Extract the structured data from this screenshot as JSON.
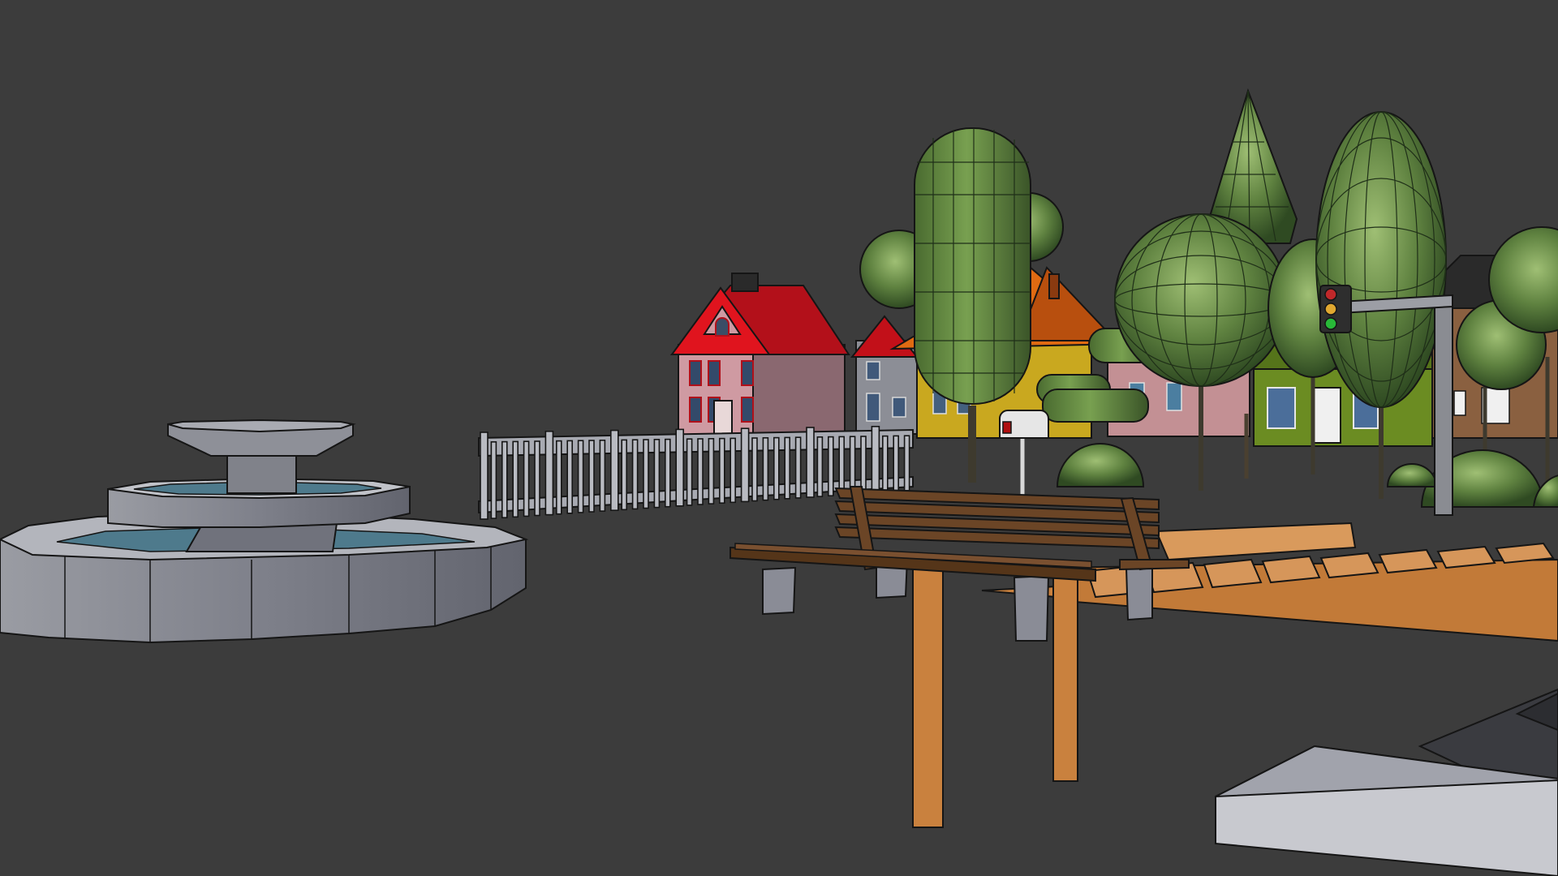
{
  "viewport": {
    "background": "#3c3c3c",
    "scene_objects": [
      "fountain",
      "fence",
      "house-red-roof",
      "house-grey",
      "house-yellow-orange-roof",
      "house-pink",
      "house-green",
      "house-brown",
      "trees",
      "mailbox",
      "traffic-light",
      "park-bench",
      "wooden-pier",
      "stone-block"
    ],
    "colors": {
      "tree_green": "#5d7f3c",
      "roof_red": "#d4121c",
      "roof_orange": "#e26b12",
      "wall_pink": "#c8949a",
      "wall_yellow": "#c8a820",
      "wall_green": "#6a8c22",
      "wood": "#c98a45",
      "bench_wood": "#6b4526",
      "stone": "#7d7f89",
      "water": "#4e7a8c",
      "outline": "#151515"
    }
  }
}
